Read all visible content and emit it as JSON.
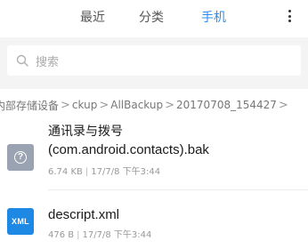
{
  "tabs": [
    {
      "label": "最近",
      "active": false
    },
    {
      "label": "分类",
      "active": false
    },
    {
      "label": "手机",
      "active": true
    }
  ],
  "menu": {
    "icon": "more-vertical-icon"
  },
  "search": {
    "placeholder": "搜索",
    "icon": "search-icon"
  },
  "breadcrumb": [
    {
      "label": "内部存储设备"
    },
    {
      "label": "ckup"
    },
    {
      "label": "AllBackup"
    },
    {
      "label": "20170708_154427"
    }
  ],
  "files": [
    {
      "name_line1": "通讯录与拨号",
      "name_line2": "(com.android.contacts).bak",
      "size": "6.74 KB",
      "date": "17/7/8 下午3:44",
      "icon": "unknown-file-icon"
    },
    {
      "name": "descript.xml",
      "size": "476 B",
      "date": "17/7/8 下午3:44",
      "icon": "xml-file-icon",
      "icon_text": "XML"
    }
  ],
  "colors": {
    "accent": "#2b8ff0",
    "xml_icon": "#1e88e5",
    "unknown_icon": "#9aa3b2"
  }
}
